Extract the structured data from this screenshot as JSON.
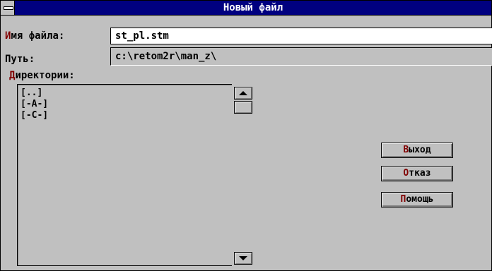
{
  "window": {
    "title": "Новый файл"
  },
  "filename": {
    "label_hot": "И",
    "label_rest": "мя файла:",
    "value": "st_pl.stm"
  },
  "path": {
    "label": "Путь:",
    "value": "c:\\retom2r\\man_z\\"
  },
  "directories": {
    "label_hot": "Д",
    "label_rest": "иректории:",
    "items": [
      "[..]",
      "[-A-]",
      "[-C-]"
    ]
  },
  "buttons": {
    "exit": {
      "hot": "В",
      "rest": "ыход"
    },
    "cancel": {
      "hot": "О",
      "rest": "тказ"
    },
    "help": {
      "hot": "П",
      "rest": "омощь"
    }
  },
  "icons": {
    "system_menu": "system-menu-icon",
    "scroll_up": "arrow-up-icon",
    "scroll_down": "arrow-down-icon"
  },
  "colors": {
    "titlebar": "#000080",
    "hotkey": "#800000",
    "face": "#c0c0c0"
  }
}
